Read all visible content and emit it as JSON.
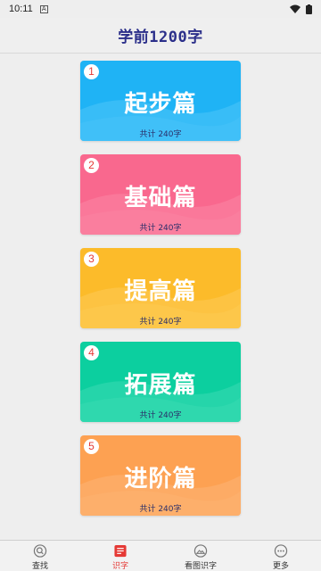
{
  "status": {
    "time": "10:11",
    "a_label": "A"
  },
  "header": {
    "title": "学前1200字"
  },
  "cards": [
    {
      "num": "1",
      "name": "起步篇",
      "count": "共计 240字",
      "color": "#1fb3f5",
      "color2": "#4cc4f8"
    },
    {
      "num": "2",
      "name": "基础篇",
      "count": "共计 240字",
      "color": "#f9688e",
      "color2": "#fb85a4"
    },
    {
      "num": "3",
      "name": "提高篇",
      "count": "共计 240字",
      "color": "#fcbb2a",
      "color2": "#fdcb55"
    },
    {
      "num": "4",
      "name": "拓展篇",
      "count": "共计 240字",
      "color": "#0ccf9f",
      "color2": "#3bdbb3"
    },
    {
      "num": "5",
      "name": "进阶篇",
      "count": "共计 240字",
      "color": "#fda152",
      "color2": "#fdb474"
    }
  ],
  "tabs": [
    {
      "label": "查找",
      "icon": "search-icon"
    },
    {
      "label": "识字",
      "icon": "book-icon",
      "active": true
    },
    {
      "label": "看图识字",
      "icon": "image-icon"
    },
    {
      "label": "更多",
      "icon": "more-icon"
    }
  ]
}
